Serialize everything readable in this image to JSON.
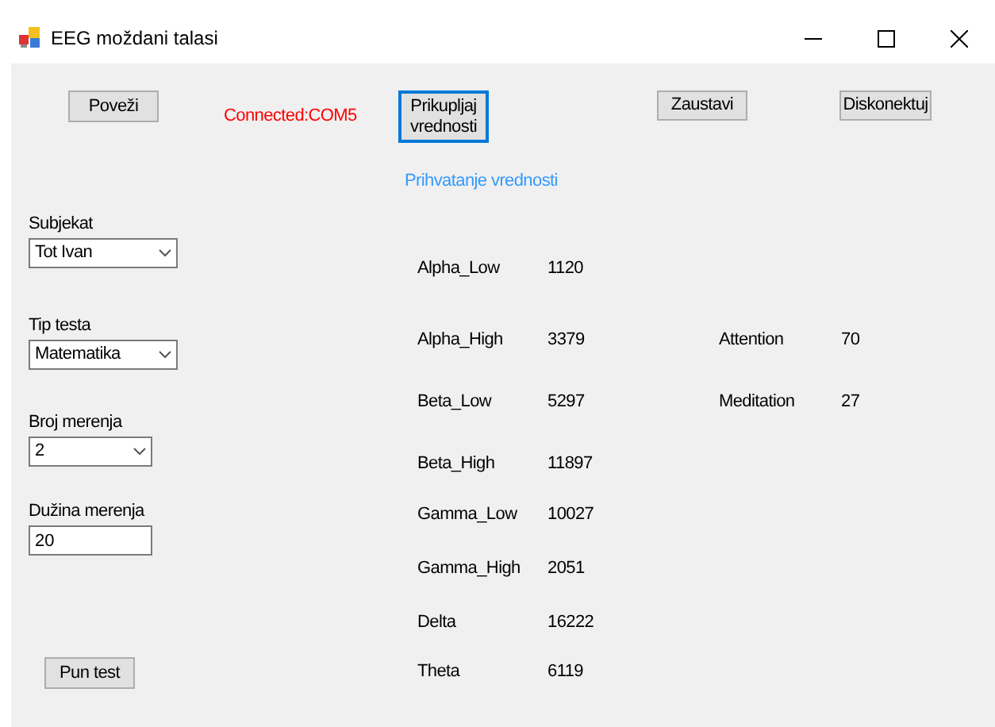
{
  "window": {
    "title": "EEG moždani talasi"
  },
  "top_buttons": [
    {
      "label": "Poveži",
      "focused": false
    },
    {
      "label": "Prikupljaj vrednosti",
      "focused": true
    },
    {
      "label": "Zaustavi",
      "focused": false
    },
    {
      "label": "Diskonektuj",
      "focused": false
    }
  ],
  "connection_status": "Connected:COM5",
  "status_message": "Prihvatanje vrednosti",
  "fields": [
    {
      "kind": "combo",
      "label": "Subjekat",
      "value": "Tot Ivan"
    },
    {
      "kind": "combo",
      "label": "Tip testa",
      "value": "Matematika"
    },
    {
      "kind": "combo",
      "label": "Broj merenja",
      "value": "2"
    },
    {
      "kind": "text",
      "label": "Dužina merenja",
      "value": "20"
    }
  ],
  "run_button": "Pun test",
  "waves": [
    {
      "name": "Alpha_Low",
      "value": "1120"
    },
    {
      "name": "Alpha_High",
      "value": "3379"
    },
    {
      "name": "Beta_Low",
      "value": "5297"
    },
    {
      "name": "Beta_High",
      "value": "11897"
    },
    {
      "name": "Gamma_Low",
      "value": "10027"
    },
    {
      "name": "Gamma_High",
      "value": "2051"
    },
    {
      "name": "Delta",
      "value": "16222"
    },
    {
      "name": "Theta",
      "value": "6119"
    }
  ],
  "metrics": [
    {
      "name": "Attention",
      "value": "70"
    },
    {
      "name": "Meditation",
      "value": "27"
    }
  ]
}
